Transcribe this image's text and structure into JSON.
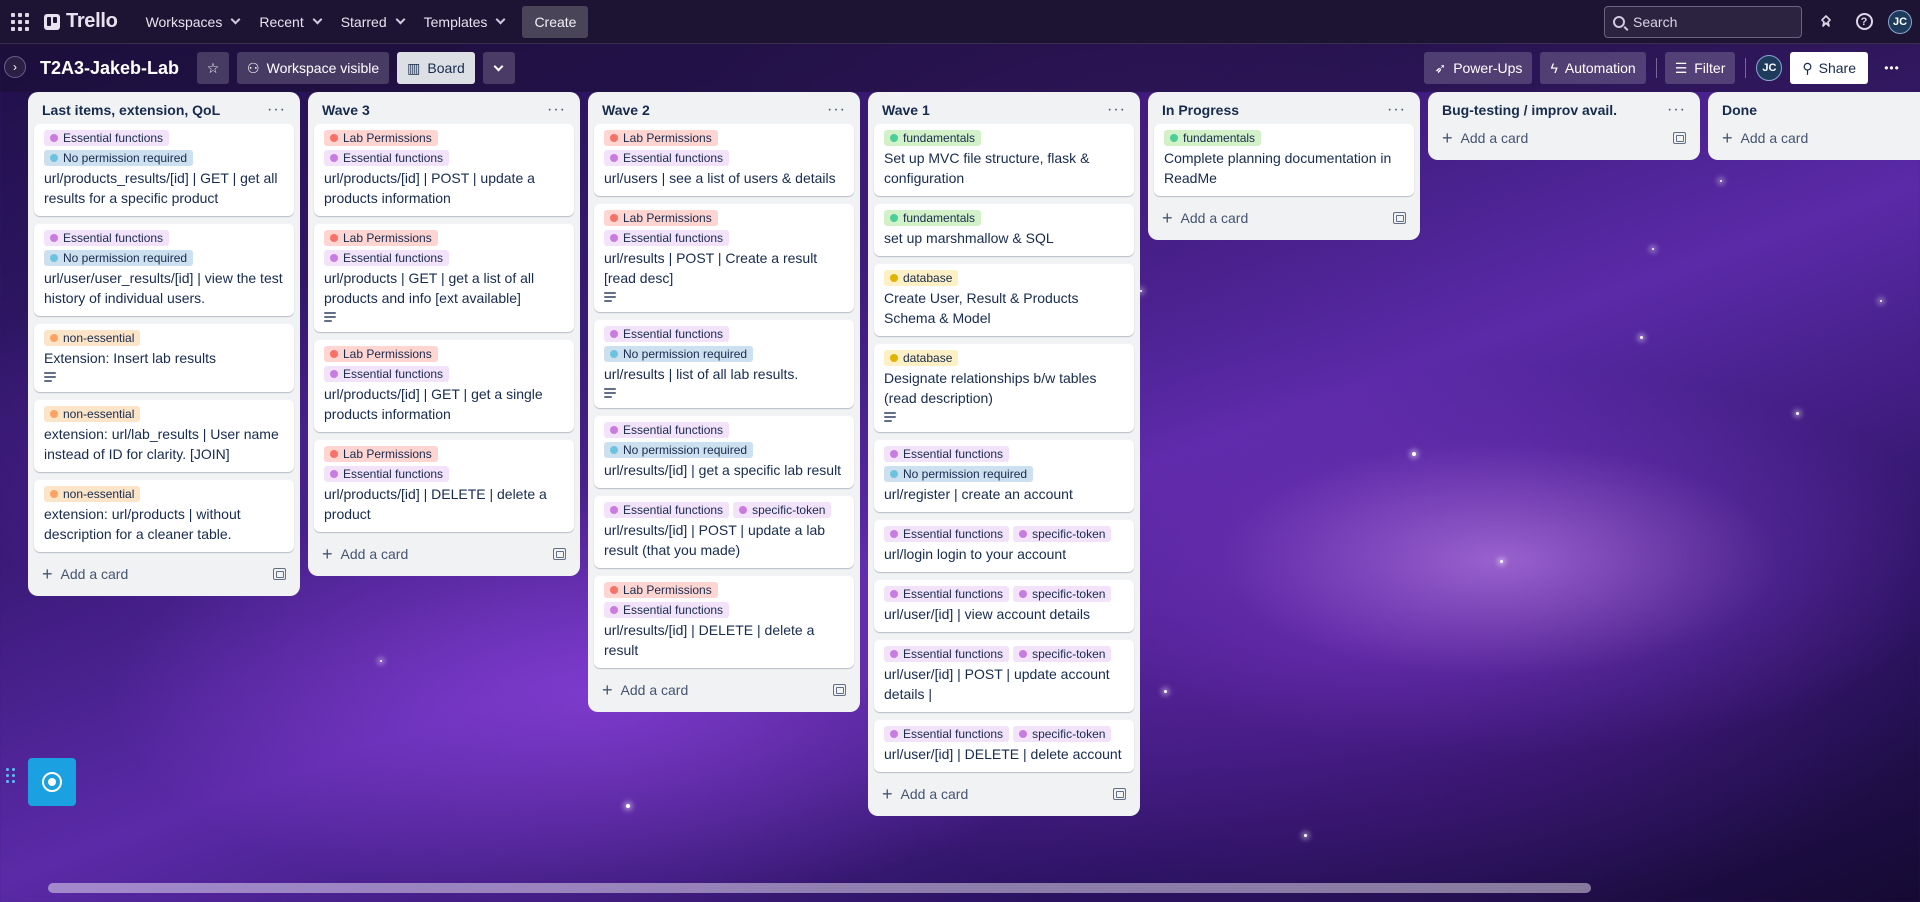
{
  "nav": {
    "logo_text": "Trello",
    "menus": [
      "Workspaces",
      "Recent",
      "Starred",
      "Templates"
    ],
    "create_label": "Create",
    "search_placeholder": "Search",
    "avatar_initials": "JC"
  },
  "board": {
    "title": "T2A3-Jakeb-Lab",
    "visibility_label": "Workspace visible",
    "view_label": "Board",
    "powerups_label": "Power-Ups",
    "automation_label": "Automation",
    "filter_label": "Filter",
    "member_initials": "JC",
    "share_label": "Share",
    "more_label": "•••"
  },
  "label_colors": {
    "Essential functions": {
      "bg": "#f3e3fa",
      "dot": "#c97ce0"
    },
    "No permission required": {
      "bg": "#cce0f0",
      "dot": "#6cc3e0"
    },
    "Lab Permissions": {
      "bg": "#ffd5d2",
      "dot": "#f87168"
    },
    "non-essential": {
      "bg": "#fce4c9",
      "dot": "#fea362"
    },
    "specific-token": {
      "bg": "#f3e3fa",
      "dot": "#c97ce0"
    },
    "fundamentals": {
      "bg": "#d3f1c8",
      "dot": "#4bce97"
    },
    "database": {
      "bg": "#fdf0c4",
      "dot": "#e2b203"
    }
  },
  "add_card_label": "Add a card",
  "lists": [
    {
      "title": "Last items, extension, QoL",
      "cards": [
        {
          "labels": [
            "Essential functions",
            "No permission required"
          ],
          "title": "url/products_results/[id] | GET | get all results for a specific product",
          "desc": false
        },
        {
          "labels": [
            "Essential functions",
            "No permission required"
          ],
          "title": "url/user/user_results/[id] | view the test history of individual users.",
          "desc": false
        },
        {
          "labels": [
            "non-essential"
          ],
          "title": "Extension: Insert lab results",
          "desc": true
        },
        {
          "labels": [
            "non-essential"
          ],
          "title": "extension: url/lab_results | User name instead of ID for clarity. [JOIN]",
          "desc": false
        },
        {
          "labels": [
            "non-essential"
          ],
          "title": "extension: url/products | without description for a cleaner table.",
          "desc": false
        }
      ]
    },
    {
      "title": "Wave 3",
      "cards": [
        {
          "labels": [
            "Lab Permissions",
            "Essential functions"
          ],
          "title": "url/products/[id] | POST | update a products information",
          "desc": false
        },
        {
          "labels": [
            "Lab Permissions",
            "Essential functions"
          ],
          "title": "url/products | GET | get a list of all products and info [ext available]",
          "desc": true
        },
        {
          "labels": [
            "Lab Permissions",
            "Essential functions"
          ],
          "title": "url/products/[id] | GET | get a single products information",
          "desc": false
        },
        {
          "labels": [
            "Lab Permissions",
            "Essential functions"
          ],
          "title": "url/products/[id] | DELETE | delete a product",
          "desc": false
        }
      ]
    },
    {
      "title": "Wave 2",
      "cards": [
        {
          "labels": [
            "Lab Permissions",
            "Essential functions"
          ],
          "title": "url/users | see a list of users & details",
          "desc": false
        },
        {
          "labels": [
            "Lab Permissions",
            "Essential functions"
          ],
          "title": "url/results | POST | Create a result [read desc]",
          "desc": true
        },
        {
          "labels": [
            "Essential functions",
            "No permission required"
          ],
          "title": "url/results | list of all lab results.",
          "desc": true
        },
        {
          "labels": [
            "Essential functions",
            "No permission required"
          ],
          "title": "url/results/[id] | get a specific lab result",
          "desc": false
        },
        {
          "labels": [
            "Essential functions",
            "specific-token"
          ],
          "title": "url/results/[id] | POST | update a lab result (that you made)",
          "desc": false
        },
        {
          "labels": [
            "Lab Permissions",
            "Essential functions"
          ],
          "title": "url/results/[id] | DELETE | delete a result",
          "desc": false
        }
      ]
    },
    {
      "title": "Wave 1",
      "cards": [
        {
          "labels": [
            "fundamentals"
          ],
          "title": "Set up MVC file structure, flask & configuration",
          "desc": false
        },
        {
          "labels": [
            "fundamentals"
          ],
          "title": "set up marshmallow & SQL",
          "desc": false
        },
        {
          "labels": [
            "database"
          ],
          "title": "Create User, Result & Products Schema & Model",
          "desc": false
        },
        {
          "labels": [
            "database"
          ],
          "title": "Designate relationships b/w tables (read description)",
          "desc": true
        },
        {
          "labels": [
            "Essential functions",
            "No permission required"
          ],
          "title": "url/register | create an account",
          "desc": false
        },
        {
          "labels": [
            "Essential functions",
            "specific-token"
          ],
          "title": "url/login login to your account",
          "desc": false
        },
        {
          "labels": [
            "Essential functions",
            "specific-token"
          ],
          "title": "url/user/[id] | view account details",
          "desc": false
        },
        {
          "labels": [
            "Essential functions",
            "specific-token"
          ],
          "title": "url/user/[id] | POST | update account details |",
          "desc": false
        },
        {
          "labels": [
            "Essential functions",
            "specific-token"
          ],
          "title": "url/user/[id] | DELETE | delete account",
          "desc": false
        }
      ]
    },
    {
      "title": "In Progress",
      "cards": [
        {
          "labels": [
            "fundamentals"
          ],
          "title": "Complete planning documentation in ReadMe",
          "desc": false
        }
      ]
    },
    {
      "title": "Bug-testing / improv avail.",
      "cards": []
    },
    {
      "title": "Done",
      "cards": []
    }
  ]
}
